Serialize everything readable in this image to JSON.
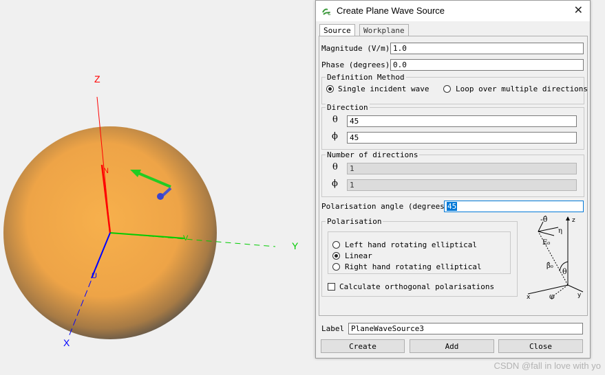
{
  "viewport": {
    "axes": {
      "z_label": "Z",
      "y_label": "Y",
      "x_label": "X"
    },
    "sphere_markers": {
      "n_label": "N",
      "v_label": "V",
      "u_label": "U"
    },
    "colors": {
      "x_axis": "#0000ff",
      "y_axis": "#00cc00",
      "z_axis": "#ff0000",
      "sphere": "#f0a848"
    }
  },
  "dialog": {
    "title": "Create Plane Wave Source",
    "close_icon": "close-icon",
    "tabs": [
      {
        "label": "Source"
      },
      {
        "label": "Workplane"
      }
    ],
    "magnitude": {
      "label": "Magnitude (V/m)",
      "value": "1.0"
    },
    "phase": {
      "label": "Phase (degrees)",
      "value": "0.0"
    },
    "definition_method": {
      "title": "Definition Method",
      "options": [
        {
          "label": "Single incident wave",
          "selected": true
        },
        {
          "label": "Loop over multiple directions",
          "selected": false
        }
      ]
    },
    "direction": {
      "title": "Direction",
      "theta_symbol": "θ",
      "theta_value": "45",
      "phi_symbol": "ϕ",
      "phi_value": "45"
    },
    "num_directions": {
      "title": "Number of directions",
      "theta_symbol": "θ",
      "theta_value": "1",
      "phi_symbol": "ϕ",
      "phi_value": "1"
    },
    "polarisation_angle": {
      "label": "Polarisation angle (degrees)",
      "value": "45"
    },
    "polarisation": {
      "title": "Polarisation",
      "options": [
        {
          "label": "Left hand rotating elliptical",
          "selected": false
        },
        {
          "label": "Linear",
          "selected": true
        },
        {
          "label": "Right hand rotating elliptical",
          "selected": false
        }
      ],
      "orthogonal_label": "Calculate orthogonal polarisations"
    },
    "diagram": {
      "theta_hat": "-θ̂",
      "eta": "η",
      "e0": "E₀",
      "beta0": "β̂₀",
      "theta": "θ",
      "phi": "φ",
      "x": "x",
      "y": "y",
      "z": "z"
    },
    "label": {
      "label": "Label",
      "value": "PlaneWaveSource3"
    },
    "buttons": {
      "create": "Create",
      "add": "Add",
      "close": "Close"
    }
  },
  "watermark": "CSDN @fall in love with yo"
}
